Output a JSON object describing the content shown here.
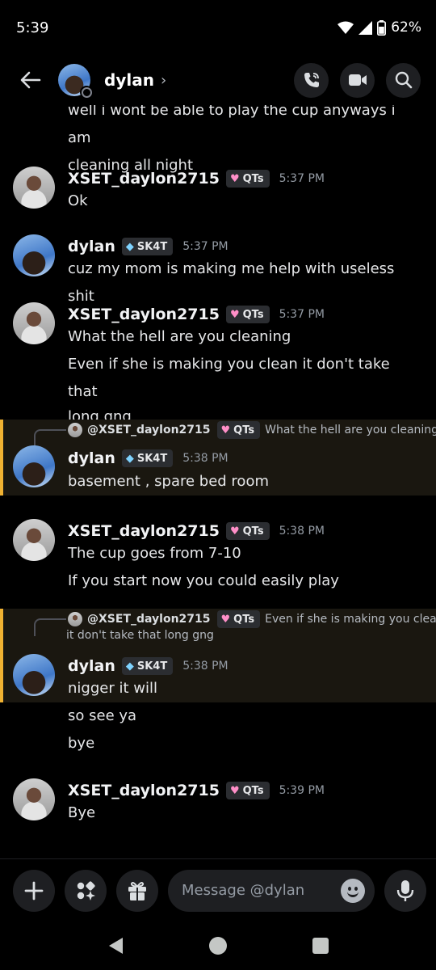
{
  "status_bar": {
    "time": "5:39",
    "battery": "62%"
  },
  "header": {
    "name": "dylan",
    "chevron": "›"
  },
  "composer": {
    "placeholder": "Message @dylan"
  },
  "messages": {
    "partial": {
      "lines": [
        "well i wont be able to play the cup anyways i am",
        "cleaning all night"
      ]
    },
    "g1": {
      "username": "XSET_daylon2715",
      "tag": "QTs",
      "time": "5:37 PM",
      "lines": [
        "Ok"
      ]
    },
    "g2": {
      "username": "dylan",
      "tag": "SK4T",
      "time": "5:37 PM",
      "lines": [
        "cuz my mom is making me help with useless shit"
      ]
    },
    "g3": {
      "username": "XSET_daylon2715",
      "tag": "QTs",
      "time": "5:37 PM",
      "lines": [
        "What the hell are you cleaning",
        "Even if she is making you clean it don't take that",
        "long gng"
      ]
    },
    "g4": {
      "reply": {
        "name": "@XSET_daylon2715",
        "tag": "QTs",
        "text": "What the hell are you cleaning"
      },
      "username": "dylan",
      "tag": "SK4T",
      "time": "5:38 PM",
      "lines": [
        "basement ,  spare bed room"
      ]
    },
    "g5": {
      "username": "XSET_daylon2715",
      "tag": "QTs",
      "time": "5:38 PM",
      "lines": [
        "The cup goes from 7-10",
        "If you start now you could easily play"
      ]
    },
    "g6": {
      "reply": {
        "name": "@XSET_daylon2715",
        "tag": "QTs",
        "text": "Even if she is making you clean",
        "text2": "it don't take that long gng"
      },
      "username": "dylan",
      "tag": "SK4T",
      "time": "5:38 PM",
      "lines": [
        "nigger it will",
        "so see ya",
        "bye"
      ]
    },
    "g7": {
      "username": "XSET_daylon2715",
      "tag": "QTs",
      "time": "5:39 PM",
      "lines": [
        "Bye"
      ]
    }
  },
  "icons": {
    "back": "arrow-left-icon",
    "call": "phone-icon",
    "video": "video-icon",
    "search": "search-icon",
    "plus": "plus-icon",
    "apps": "apps-icon",
    "gift": "gift-icon",
    "emoji": "emoji-icon",
    "mic": "mic-icon"
  },
  "colors": {
    "background": "#000000",
    "reply_highlight": "#f0b232",
    "qts_heart": "#ff8fc8",
    "sk4t_gem": "#7fd3ff"
  }
}
